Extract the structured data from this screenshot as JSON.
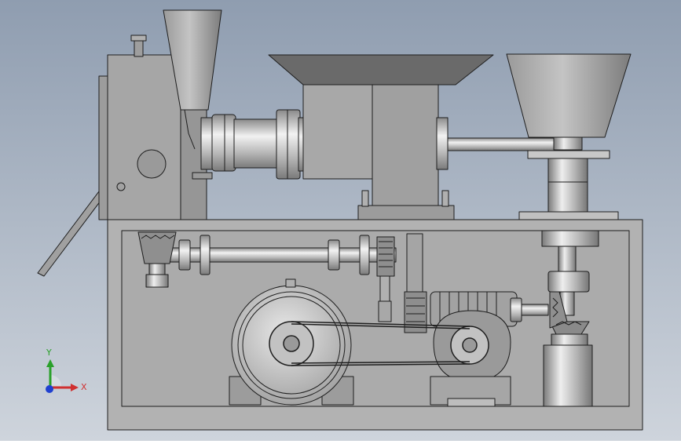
{
  "view": {
    "background_top": "#8f9db0",
    "background_bottom": "#ced4dc",
    "line_color": "#1e1e1e",
    "metal_light": "#d8d8d8",
    "metal_mid": "#a8a8a8",
    "metal_dark": "#6e6e6e",
    "frame_color": "#b2b2b2"
  },
  "triad": {
    "x_label": "X",
    "y_label": "Y",
    "x_color": "#d03030",
    "y_color": "#2aa02a",
    "z_color": "#2040d0"
  }
}
